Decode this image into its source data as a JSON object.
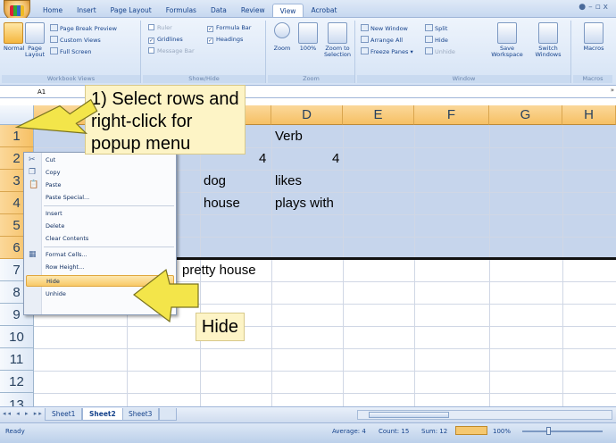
{
  "ribbon": {
    "tabs": [
      "Home",
      "Insert",
      "Page Layout",
      "Formulas",
      "Data",
      "Review",
      "View",
      "Acrobat"
    ],
    "active_tab": "View",
    "groups": {
      "workbook_views": {
        "label": "Workbook Views",
        "normal": "Normal",
        "page_layout": "Page Layout",
        "page_break_preview": "Page Break Preview",
        "custom_views": "Custom Views",
        "full_screen": "Full Screen"
      },
      "show_hide": {
        "label": "Show/Hide",
        "ruler": "Ruler",
        "gridlines": "Gridlines",
        "message_bar": "Message Bar",
        "formula_bar": "Formula Bar",
        "headings": "Headings"
      },
      "zoom": {
        "label": "Zoom",
        "zoom": "Zoom",
        "hundred": "100%",
        "zoom_to_selection": "Zoom to Selection"
      },
      "window": {
        "label": "Window",
        "new_window": "New Window",
        "arrange_all": "Arrange All",
        "freeze_panes": "Freeze Panes",
        "split": "Split",
        "hide": "Hide",
        "unhide": "Unhide",
        "save_workspace": "Save Workspace",
        "switch_windows": "Switch Windows"
      },
      "macros": {
        "label": "Macros",
        "macros": "Macros"
      }
    }
  },
  "formula_bar": {
    "name_box": "A1"
  },
  "grid": {
    "columns": [
      "D",
      "E",
      "F",
      "G",
      "H"
    ],
    "rows": [
      "1",
      "2",
      "3",
      "4",
      "5",
      "6",
      "7",
      "8",
      "9",
      "10",
      "11",
      "12",
      "13"
    ],
    "cells": {
      "d1": "Verb",
      "c2_tail": "4",
      "d2": "4",
      "c3": "dog",
      "d3": "likes",
      "c4": "house",
      "d4": "plays with",
      "c7": "pretty house"
    }
  },
  "context_menu": {
    "items": {
      "cut": "Cut",
      "copy": "Copy",
      "paste": "Paste",
      "paste_special": "Paste Special...",
      "insert": "Insert",
      "delete": "Delete",
      "clear_contents": "Clear Contents",
      "format_cells": "Format Cells...",
      "row_height": "Row Height...",
      "hide": "Hide",
      "unhide": "Unhide"
    },
    "highlighted": "Hide"
  },
  "callouts": {
    "instruction": "1) Select rows and right-click for popup menu",
    "hide_label": "Hide"
  },
  "sheets": {
    "tabs": [
      "Sheet1",
      "Sheet2",
      "Sheet3"
    ],
    "active": "Sheet2"
  },
  "status_bar": {
    "ready": "Ready",
    "average": "Average: 4",
    "count": "Count: 15",
    "sum": "Sum: 12",
    "zoom": "100%"
  },
  "colors": {
    "accent_orange": "#f6c064",
    "selection_blue": "#c6d5ec",
    "callout_yellow": "#fdf4c6",
    "arrow_yellow": "#f3e54a",
    "ribbon_text": "#15428b"
  }
}
